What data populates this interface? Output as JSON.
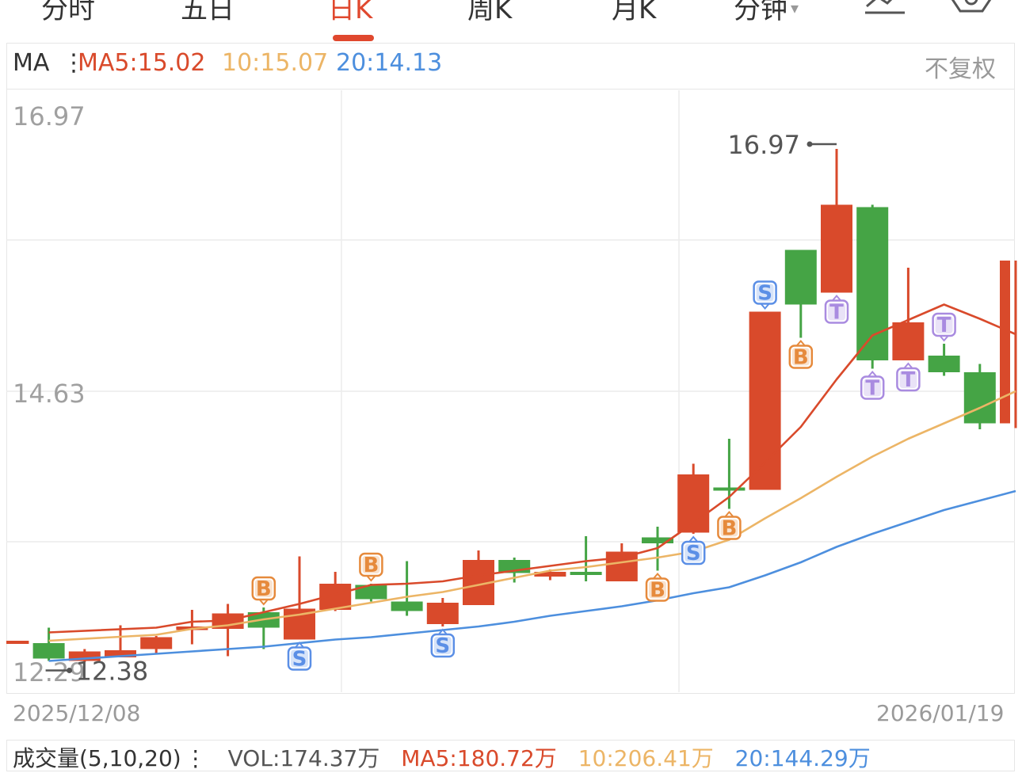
{
  "tabs": [
    {
      "label": "分时",
      "active": false
    },
    {
      "label": "五日",
      "active": false
    },
    {
      "label": "日K",
      "active": true
    },
    {
      "label": "周K",
      "active": false
    },
    {
      "label": "月K",
      "active": false
    },
    {
      "label": "分钟",
      "active": false,
      "dropdown": true
    }
  ],
  "icons": {
    "chart": "line-chart-icon",
    "settings": "hexagon-settings-icon",
    "dropdown": "chevron-down-icon"
  },
  "ma_header": {
    "label": "MA",
    "ma5": "MA5:15.02",
    "ma10": "10:15.07",
    "ma20": "20:14.13",
    "adjust": "不复权"
  },
  "colors": {
    "up": "#d94a2b",
    "down": "#45a445",
    "ma5": "#d94a2b",
    "ma10": "#ecb566",
    "ma20": "#4d8fde",
    "buy": "#e68a3c",
    "sell": "#5b8fe6",
    "t": "#a98be0",
    "accent": "#e0482e"
  },
  "chart_data": {
    "type": "candlestick",
    "ylim": [
      12.29,
      16.97
    ],
    "y_ticks": [
      "16.97",
      "14.63",
      "12.29"
    ],
    "x_labels": {
      "start": "2025/12/08",
      "end": "2026/01/19"
    },
    "max_label": "16.97",
    "min_label": "12.38",
    "candles": [
      {
        "o": 12.55,
        "c": 12.55,
        "h": 12.55,
        "l": 12.55
      },
      {
        "o": 12.53,
        "c": 12.4,
        "h": 12.66,
        "l": 12.38
      },
      {
        "o": 12.38,
        "c": 12.46,
        "h": 12.48,
        "l": 12.37
      },
      {
        "o": 12.41,
        "c": 12.47,
        "h": 12.68,
        "l": 12.41
      },
      {
        "o": 12.48,
        "c": 12.58,
        "h": 12.59,
        "l": 12.44
      },
      {
        "o": 12.64,
        "c": 12.67,
        "h": 12.81,
        "l": 12.52
      },
      {
        "o": 12.65,
        "c": 12.78,
        "h": 12.86,
        "l": 12.42
      },
      {
        "o": 12.79,
        "c": 12.66,
        "h": 12.83,
        "l": 12.48
      },
      {
        "o": 12.56,
        "c": 12.82,
        "h": 13.26,
        "l": 12.56
      },
      {
        "o": 12.81,
        "c": 13.03,
        "h": 13.13,
        "l": 12.8
      },
      {
        "o": 13.02,
        "c": 12.9,
        "h": 13.03,
        "l": 12.88
      },
      {
        "o": 12.88,
        "c": 12.8,
        "h": 13.22,
        "l": 12.76
      },
      {
        "o": 12.69,
        "c": 12.87,
        "h": 12.91,
        "l": 12.67
      },
      {
        "o": 12.85,
        "c": 13.23,
        "h": 13.31,
        "l": 12.85
      },
      {
        "o": 13.23,
        "c": 13.12,
        "h": 13.25,
        "l": 13.04
      },
      {
        "o": 13.09,
        "c": 13.13,
        "h": 13.15,
        "l": 13.06
      },
      {
        "o": 13.13,
        "c": 13.12,
        "h": 13.43,
        "l": 13.05
      },
      {
        "o": 13.05,
        "c": 13.3,
        "h": 13.37,
        "l": 13.05
      },
      {
        "o": 13.42,
        "c": 13.37,
        "h": 13.51,
        "l": 13.14
      },
      {
        "o": 13.46,
        "c": 13.95,
        "h": 14.04,
        "l": 13.45
      },
      {
        "o": 13.84,
        "c": 13.83,
        "h": 14.25,
        "l": 13.66
      },
      {
        "o": 13.82,
        "c": 15.32,
        "h": 15.32,
        "l": 13.82
      },
      {
        "o": 15.84,
        "c": 15.38,
        "h": 15.84,
        "l": 15.1
      },
      {
        "o": 15.48,
        "c": 16.22,
        "h": 16.69,
        "l": 15.48
      },
      {
        "o": 16.2,
        "c": 14.91,
        "h": 16.22,
        "l": 14.84
      },
      {
        "o": 14.91,
        "c": 15.23,
        "h": 15.69,
        "l": 14.91
      },
      {
        "o": 14.95,
        "c": 14.81,
        "h": 15.05,
        "l": 14.78
      },
      {
        "o": 14.81,
        "c": 14.38,
        "h": 14.88,
        "l": 14.33
      },
      {
        "o": 14.38,
        "c": 15.75,
        "h": 15.75,
        "l": 14.34
      }
    ],
    "ma5": [
      null,
      12.62,
      null,
      null,
      12.66,
      12.71,
      12.72,
      12.79,
      12.86,
      12.94,
      13.02,
      13.03,
      13.05,
      13.1,
      13.14,
      13.18,
      13.22,
      13.25,
      13.33,
      13.54,
      13.76,
      14.05,
      14.35,
      14.75,
      15.12,
      15.25,
      15.38,
      15.26,
      15.13
    ],
    "ma10": [
      null,
      12.55,
      null,
      null,
      12.6,
      12.65,
      12.68,
      12.73,
      12.77,
      12.82,
      12.87,
      12.92,
      12.96,
      13.02,
      13.08,
      13.14,
      13.17,
      13.21,
      13.25,
      13.3,
      13.4,
      13.58,
      13.75,
      13.93,
      14.1,
      14.25,
      14.38,
      14.51,
      14.65
    ],
    "ma20": [
      null,
      12.38,
      null,
      null,
      12.44,
      12.46,
      12.48,
      12.5,
      12.53,
      12.56,
      12.58,
      12.61,
      12.64,
      12.67,
      12.71,
      12.76,
      12.8,
      12.84,
      12.89,
      12.95,
      13.0,
      13.1,
      13.21,
      13.34,
      13.45,
      13.55,
      13.65,
      13.73,
      13.81
    ],
    "markers": [
      {
        "i": 7,
        "label": "B",
        "type": "buy",
        "pos": "above"
      },
      {
        "i": 8,
        "label": "S",
        "type": "sell",
        "pos": "below"
      },
      {
        "i": 10,
        "label": "B",
        "type": "buy",
        "pos": "above"
      },
      {
        "i": 12,
        "label": "S",
        "type": "sell",
        "pos": "below"
      },
      {
        "i": 18,
        "label": "B",
        "type": "buy",
        "pos": "below"
      },
      {
        "i": 19,
        "label": "S",
        "type": "sell",
        "pos": "below"
      },
      {
        "i": 20,
        "label": "B",
        "type": "buy",
        "pos": "below"
      },
      {
        "i": 21,
        "label": "S",
        "type": "sell",
        "pos": "above"
      },
      {
        "i": 22,
        "label": "B",
        "type": "buy",
        "pos": "below"
      },
      {
        "i": 23,
        "label": "T",
        "type": "t",
        "pos": "below"
      },
      {
        "i": 24,
        "label": "T",
        "type": "t",
        "pos": "below"
      },
      {
        "i": 25,
        "label": "T",
        "type": "t",
        "pos": "below"
      },
      {
        "i": 26,
        "label": "T",
        "type": "t",
        "pos": "above"
      }
    ]
  },
  "volume_header": {
    "label": "成交量(5,10,20)",
    "vol": "VOL:174.37万",
    "ma5": "MA5:180.72万",
    "ma10": "10:206.41万",
    "ma20": "20:144.29万"
  }
}
